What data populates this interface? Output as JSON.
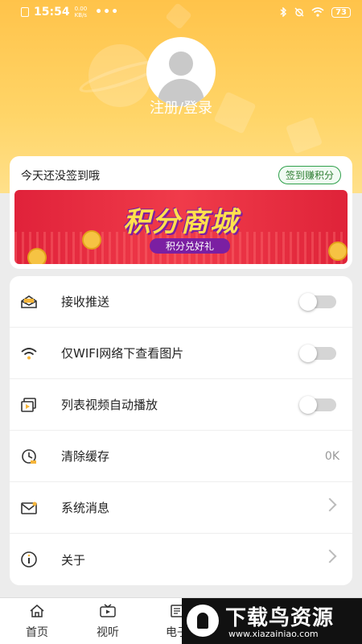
{
  "status_bar": {
    "time": "15:54",
    "net_speed_value": "0.00",
    "net_speed_unit": "KB/s",
    "more": "•••",
    "battery": "73"
  },
  "profile": {
    "login_label": "注册/登录"
  },
  "signin": {
    "prompt": "今天还没签到哦",
    "earn_button": "签到赚积分"
  },
  "banner": {
    "title": "积分商城",
    "subtitle": "积分兑好礼"
  },
  "settings": [
    {
      "icon": "envelope-open-icon",
      "label": "接收推送",
      "control": "toggle"
    },
    {
      "icon": "wifi-icon",
      "label": "仅WIFI网络下查看图片",
      "control": "toggle"
    },
    {
      "icon": "video-list-icon",
      "label": "列表视频自动播放",
      "control": "toggle"
    },
    {
      "icon": "clock-icon",
      "label": "清除缓存",
      "control": "value",
      "value": "0K"
    },
    {
      "icon": "mail-icon",
      "label": "系统消息",
      "control": "chevron"
    },
    {
      "icon": "info-icon",
      "label": "关于",
      "control": "chevron"
    }
  ],
  "tabbar": [
    {
      "icon": "home-icon",
      "label": "首页"
    },
    {
      "icon": "tv-icon",
      "label": "视听"
    },
    {
      "icon": "ebook-icon",
      "label": "电子"
    }
  ],
  "watermark": {
    "title": "下载鸟资源",
    "url": "www.xiazainiao.com"
  },
  "colors": {
    "header": "#ffc34a",
    "banner": "#e0223a",
    "accent_green": "#2e9f4a"
  }
}
